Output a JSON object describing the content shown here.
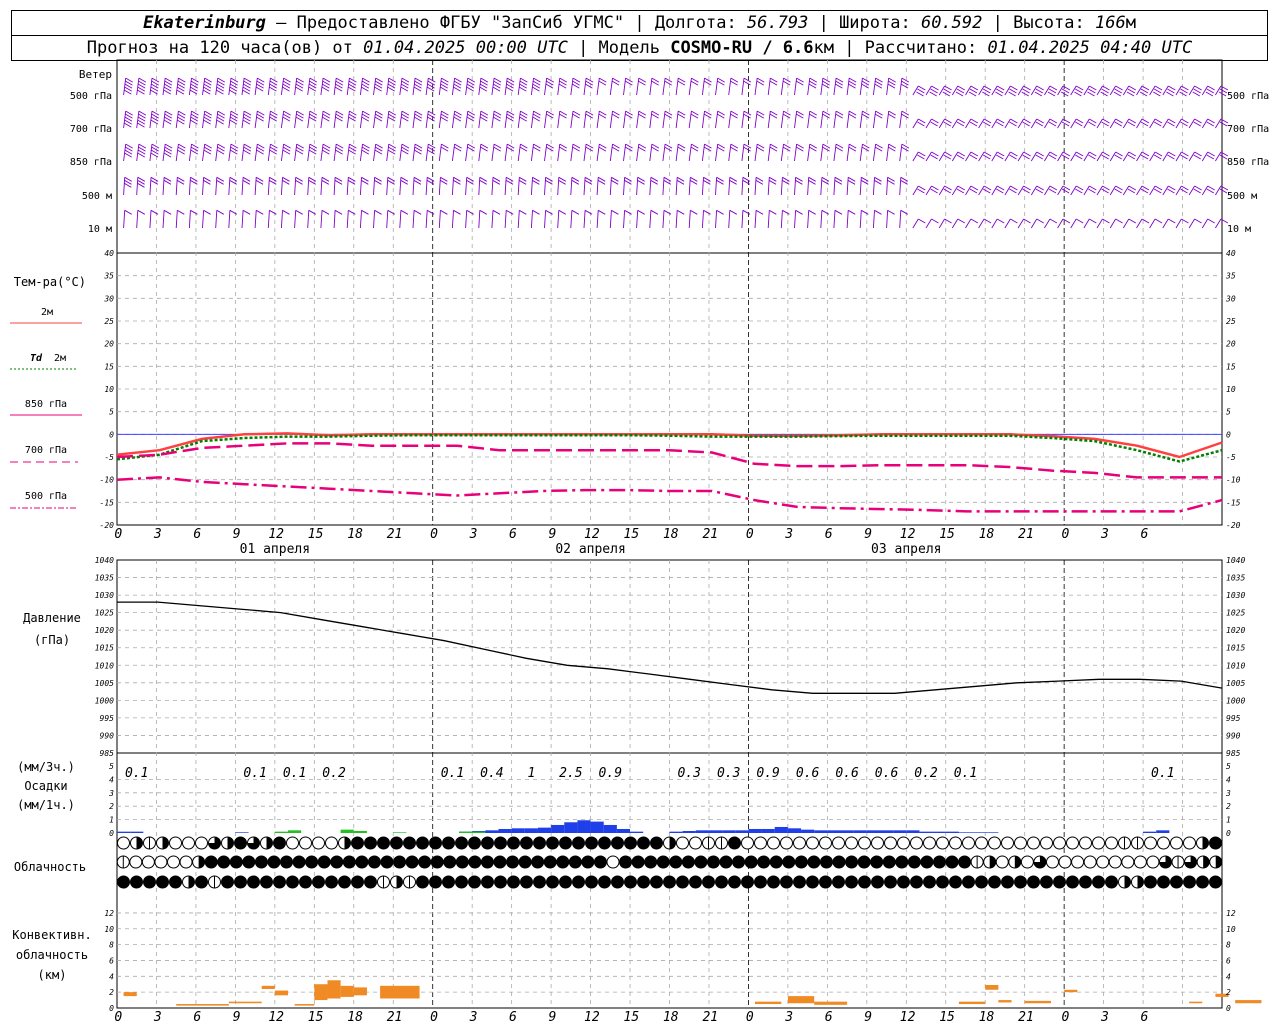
{
  "header": {
    "line1": {
      "station": "Ekaterinburg",
      "provider": " – Предоставлено ФГБУ \"ЗапСиб УГМС\" | Долгота: ",
      "lon": "56.793",
      "lat_label": " | Широта: ",
      "lat": "60.592",
      "alt_label": " | Высота: ",
      "alt": "166",
      "alt_unit": "м"
    },
    "line2": {
      "a": "Прогноз на 120 часа(ов) от ",
      "date": "01.04.2025 00:00 UTC",
      "b": "  | Модель ",
      "model": "COSMO-RU / 6.6",
      "c": "км | Рассчитано: ",
      "calc": "01.04.2025 04:40 UTC"
    }
  },
  "labels": {
    "wind": "Ветер",
    "wind_levels": [
      "500 гПа",
      "700 гПа",
      "850 гПа",
      "500 м",
      "10  м"
    ],
    "temp": "Тем-ра(°С)",
    "t2m": "2м",
    "td": "Td",
    "td2m": "2м",
    "t850": "850 гПа",
    "t700": "700 гПа",
    "t500": "500 гПа",
    "pressure": "Давление",
    "pressure_unit": "(гПа)",
    "precip_unit3": "(мм/3ч.)",
    "precip": "Осадки",
    "precip_unit1": "(мм/1ч.)",
    "cloud": "Облачность",
    "conv1": "Конвективн.",
    "conv2": "облачность",
    "conv3": "(км)"
  },
  "colors": {
    "t2m": "#ff4040",
    "td": "#008000",
    "upper": "#e8007a",
    "wind": "#8000c8",
    "precip_blue": "#1f3fe8",
    "precip_green": "#22c022",
    "conv": "#f08a24",
    "pressure": "#000000",
    "zero": "#4040ff"
  },
  "chart_data": [
    {
      "type": "barbs",
      "title": "Ветер",
      "levels": [
        "500 гПа",
        "700 гПа",
        "850 гПа",
        "500 м",
        "10  м"
      ],
      "speed_ms": {
        "500 гПа": [
          30,
          30,
          28,
          26,
          24,
          22,
          20,
          18,
          18,
          18,
          18,
          18,
          20,
          20,
          20,
          18,
          16,
          14,
          12,
          12,
          12,
          12,
          12,
          12,
          12,
          12,
          14,
          14,
          14,
          14,
          14,
          14,
          14,
          14,
          14,
          14,
          14,
          14,
          14,
          14,
          14
        ],
        "700 гПа": [
          24,
          22,
          20,
          18,
          18,
          16,
          14,
          14,
          14,
          14,
          14,
          14,
          14,
          14,
          14,
          14,
          12,
          12,
          12,
          10,
          10,
          10,
          10,
          10,
          10,
          10,
          10,
          12,
          12,
          12,
          12,
          12,
          12,
          12,
          12,
          12,
          12,
          12,
          12,
          12,
          12
        ],
        "850 гПа": [
          20,
          18,
          16,
          14,
          14,
          14,
          14,
          14,
          14,
          14,
          14,
          14,
          12,
          12,
          12,
          12,
          12,
          12,
          10,
          10,
          10,
          10,
          10,
          10,
          10,
          10,
          10,
          10,
          10,
          10,
          10,
          10,
          10,
          10,
          10,
          10,
          10,
          10,
          10,
          10,
          10
        ],
        "500 м": [
          14,
          12,
          10,
          10,
          10,
          10,
          10,
          10,
          10,
          10,
          10,
          10,
          10,
          10,
          10,
          10,
          10,
          10,
          10,
          8,
          8,
          8,
          8,
          8,
          8,
          8,
          8,
          8,
          8,
          8,
          8,
          8,
          8,
          8,
          8,
          8,
          8,
          8,
          8,
          8,
          8
        ],
        "10  м": [
          4,
          4,
          4,
          4,
          4,
          4,
          4,
          4,
          4,
          4,
          4,
          4,
          4,
          4,
          4,
          4,
          4,
          4,
          4,
          4,
          4,
          4,
          4,
          4,
          4,
          4,
          4,
          4,
          4,
          4,
          4,
          4,
          4,
          4,
          4,
          4,
          4,
          4,
          4,
          4,
          4
        ]
      }
    },
    {
      "type": "line",
      "title": "Тем-ра(°С)",
      "ylim": [
        -20,
        40
      ],
      "x_hours": [
        0,
        3,
        6,
        9,
        12,
        15,
        18,
        21,
        24,
        27,
        30,
        33,
        36,
        39,
        42,
        45,
        48,
        51,
        54,
        57,
        60,
        63,
        66,
        69,
        72,
        75,
        78,
        81,
        84
      ],
      "x_ticks": [
        "0",
        "3",
        "6",
        "9",
        "12",
        "15",
        "18",
        "21",
        "0",
        "3",
        "6",
        "9",
        "12",
        "15",
        "18",
        "21",
        "0",
        "3",
        "6",
        "9",
        "12",
        "15",
        "18",
        "21",
        "0",
        "3",
        "6"
      ],
      "day_labels": [
        "01 апреля",
        "02 апреля",
        "03 апреля"
      ],
      "series": [
        {
          "name": "2м",
          "values": [
            -4.5,
            -3.5,
            -1,
            0,
            0.2,
            -0.2,
            0,
            0,
            0,
            0,
            0,
            0,
            0,
            0,
            0,
            -0.3,
            -0.3,
            -0.2,
            0,
            0,
            0,
            0,
            -0.4,
            -1,
            -2.5,
            -5,
            -1.8
          ]
        },
        {
          "name": "Td 2м",
          "values": [
            -5.5,
            -4.5,
            -1.5,
            -0.8,
            -0.5,
            -0.5,
            -0.3,
            -0.2,
            -0.2,
            -0.2,
            -0.2,
            -0.2,
            -0.2,
            -0.3,
            -0.5,
            -0.5,
            -0.5,
            -0.4,
            -0.3,
            -0.3,
            -0.3,
            -0.3,
            -0.8,
            -1.5,
            -3.5,
            -6,
            -3.5
          ]
        },
        {
          "name": "850 гПа",
          "values": [
            -5,
            -4.5,
            -3,
            -2.5,
            -2,
            -2,
            -2.5,
            -2.5,
            -2.5,
            -3.5,
            -3.5,
            -3.5,
            -3.5,
            -3.5,
            -4,
            -6.5,
            -7,
            -7,
            -6.8,
            -6.8,
            -6.8,
            -7.2,
            -8,
            -8.5,
            -9.5,
            -9.5,
            -9.5
          ]
        },
        {
          "name": "700 гПа",
          "values": [
            -10,
            -9.5,
            -10.5,
            -11,
            -11.5,
            -12,
            -12.5,
            -13,
            -13.5,
            -13,
            -12.5,
            -12.3,
            -12.3,
            -12.5,
            -12.5,
            -14.5,
            -16,
            -16.3,
            -16.5,
            -16.7,
            -17,
            -17,
            -17,
            -17,
            -17,
            -17,
            -14.5
          ]
        },
        {
          "name": "500 гПа",
          "values": []
        }
      ]
    },
    {
      "type": "line",
      "title": "Давление",
      "ylim": [
        985,
        1040
      ],
      "x_hours": [
        0,
        3,
        6,
        9,
        12,
        15,
        18,
        21,
        24,
        27,
        30,
        33,
        36,
        39,
        42,
        45,
        48,
        51,
        54,
        57,
        60,
        63,
        66,
        69,
        72,
        75,
        78,
        81,
        84
      ],
      "series": [
        {
          "name": "Давление",
          "values": [
            1028,
            1028,
            1027,
            1026,
            1025,
            1023,
            1021,
            1019,
            1017,
            1014.5,
            1012,
            1010,
            1009,
            1007.5,
            1006,
            1004.5,
            1003,
            1002,
            1002,
            1002,
            1003,
            1004,
            1005,
            1005.5,
            1006,
            1006,
            1005.5,
            1003.5
          ]
        }
      ]
    },
    {
      "type": "bar",
      "title": "Осадки",
      "ylim": [
        0,
        5
      ],
      "labels_3h": [
        {
          "h": 1.5,
          "v": "0.1"
        },
        {
          "h": 10.5,
          "v": "0.1"
        },
        {
          "h": 13.5,
          "v": "0.1"
        },
        {
          "h": 16.5,
          "v": "0.2"
        },
        {
          "h": 25.5,
          "v": "0.1"
        },
        {
          "h": 28.5,
          "v": "0.4"
        },
        {
          "h": 31.5,
          "v": "1"
        },
        {
          "h": 34.5,
          "v": "2.5"
        },
        {
          "h": 37.5,
          "v": "0.9"
        },
        {
          "h": 43.5,
          "v": "0.3"
        },
        {
          "h": 46.5,
          "v": "0.3"
        },
        {
          "h": 49.5,
          "v": "0.9"
        },
        {
          "h": 52.5,
          "v": "0.6"
        },
        {
          "h": 55.5,
          "v": "0.6"
        },
        {
          "h": 58.5,
          "v": "0.6"
        },
        {
          "h": 61.5,
          "v": "0.2"
        },
        {
          "h": 64.5,
          "v": "0.1"
        },
        {
          "h": 79.5,
          "v": "0.1"
        }
      ],
      "hourly_blue": [
        0.1,
        0.1,
        0,
        0,
        0,
        0,
        0,
        0,
        0,
        0.05,
        0,
        0,
        0,
        0,
        0,
        0,
        0,
        0,
        0,
        0,
        0,
        0,
        0,
        0,
        0,
        0,
        0.1,
        0.15,
        0.2,
        0.3,
        0.35,
        0.35,
        0.4,
        0.6,
        0.8,
        0.95,
        0.85,
        0.6,
        0.3,
        0.1,
        0,
        0,
        0.1,
        0.15,
        0.2,
        0.2,
        0.2,
        0.2,
        0.3,
        0.3,
        0.45,
        0.35,
        0.25,
        0.2,
        0.2,
        0.2,
        0.2,
        0.2,
        0.2,
        0.2,
        0.2,
        0.1,
        0.1,
        0.1,
        0.05,
        0.05,
        0.05,
        0,
        0,
        0,
        0,
        0,
        0,
        0,
        0,
        0,
        0,
        0,
        0.1,
        0.2
      ],
      "hourly_green": [
        0,
        0,
        0,
        0,
        0,
        0,
        0,
        0,
        0,
        0,
        0,
        0,
        0.1,
        0.2,
        0,
        0,
        0,
        0.25,
        0.15,
        0,
        0,
        0.05,
        0,
        0,
        0,
        0,
        0.1,
        0.1,
        0,
        0,
        0,
        0,
        0,
        0,
        0,
        0,
        0,
        0,
        0,
        0,
        0,
        0,
        0,
        0,
        0,
        0,
        0,
        0,
        0,
        0,
        0,
        0,
        0,
        0,
        0,
        0,
        0,
        0,
        0,
        0,
        0,
        0,
        0,
        0,
        0,
        0,
        0,
        0,
        0,
        0,
        0,
        0,
        0,
        0,
        0,
        0,
        0,
        0,
        0,
        0
      ]
    },
    {
      "type": "table",
      "title": "Облачность",
      "rows": [
        "high",
        "mid",
        "low"
      ],
      "levels": {
        "high": [
          0,
          2,
          1,
          2,
          0,
          0,
          0,
          3,
          2,
          4,
          3,
          2,
          4,
          0,
          0,
          0,
          0,
          2,
          4,
          4,
          4,
          4,
          4,
          4,
          4,
          4,
          4,
          4,
          4,
          4,
          4,
          4,
          4,
          4,
          4,
          4,
          4,
          4,
          4,
          4,
          4,
          4,
          2,
          0,
          0,
          1,
          1,
          4,
          0,
          0,
          0,
          0,
          0,
          0,
          0,
          0,
          0,
          0,
          0,
          0,
          0,
          0,
          0,
          0,
          0,
          0,
          0,
          0,
          0,
          0,
          0,
          0,
          0,
          0,
          0,
          0,
          0,
          1,
          1,
          0,
          0,
          0,
          0,
          2,
          4
        ],
        "mid": [
          1,
          0,
          0,
          0,
          0,
          0,
          2,
          4,
          4,
          4,
          4,
          4,
          4,
          4,
          4,
          4,
          4,
          4,
          4,
          4,
          4,
          4,
          4,
          4,
          4,
          4,
          4,
          4,
          4,
          4,
          4,
          4,
          4,
          4,
          4,
          4,
          4,
          4,
          4,
          0,
          4,
          4,
          4,
          4,
          4,
          4,
          4,
          4,
          4,
          4,
          4,
          4,
          4,
          4,
          4,
          4,
          4,
          4,
          4,
          4,
          4,
          4,
          4,
          4,
          4,
          4,
          4,
          4,
          1,
          2,
          0,
          2,
          0,
          3,
          0,
          0,
          0,
          0,
          0,
          0,
          0,
          0,
          0,
          3,
          1,
          3,
          2,
          2
        ],
        "low": [
          4,
          4,
          4,
          4,
          4,
          2,
          4,
          1,
          4,
          4,
          4,
          4,
          4,
          4,
          4,
          4,
          4,
          4,
          4,
          4,
          1,
          2,
          1,
          4,
          4,
          4,
          4,
          4,
          4,
          4,
          4,
          4,
          4,
          4,
          4,
          4,
          4,
          4,
          4,
          4,
          4,
          4,
          4,
          4,
          4,
          4,
          4,
          4,
          4,
          4,
          4,
          4,
          4,
          4,
          4,
          4,
          4,
          4,
          4,
          4,
          4,
          4,
          4,
          4,
          4,
          4,
          4,
          4,
          4,
          4,
          4,
          4,
          4,
          4,
          4,
          4,
          4,
          2,
          2,
          4,
          4,
          4,
          4,
          4,
          4
        ]
      }
    },
    {
      "type": "bar",
      "title": "Конвективн. облачность",
      "ylim": [
        0,
        13
      ],
      "y_ticks": [
        0,
        2,
        4,
        6,
        8,
        10,
        12
      ],
      "bars": [
        {
          "h0": 0.5,
          "h1": 1.5,
          "base": 1.5,
          "top": 2
        },
        {
          "h0": 4.5,
          "h1": 8.5,
          "base": 0.3,
          "top": 0.5
        },
        {
          "h0": 8.5,
          "h1": 11,
          "base": 0.6,
          "top": 0.8
        },
        {
          "h0": 11,
          "h1": 12,
          "base": 2.4,
          "top": 2.8
        },
        {
          "h0": 12,
          "h1": 13,
          "base": 1.6,
          "top": 2.2
        },
        {
          "h0": 13.5,
          "h1": 15,
          "base": 0.3,
          "top": 0.5
        },
        {
          "h0": 15,
          "h1": 16,
          "base": 1,
          "top": 3
        },
        {
          "h0": 16,
          "h1": 17,
          "base": 1.2,
          "top": 3.5
        },
        {
          "h0": 17,
          "h1": 18,
          "base": 1.4,
          "top": 2.8
        },
        {
          "h0": 18,
          "h1": 19,
          "base": 1.6,
          "top": 2.6
        },
        {
          "h0": 20,
          "h1": 23,
          "base": 1.2,
          "top": 2.8
        },
        {
          "h0": 48.5,
          "h1": 50.5,
          "base": 0.5,
          "top": 0.8
        },
        {
          "h0": 51,
          "h1": 53,
          "base": 0.6,
          "top": 1.5
        },
        {
          "h0": 53,
          "h1": 55.5,
          "base": 0.4,
          "top": 0.8
        },
        {
          "h0": 64,
          "h1": 66,
          "base": 0.5,
          "top": 0.8
        },
        {
          "h0": 66,
          "h1": 67,
          "base": 2.3,
          "top": 2.9
        },
        {
          "h0": 67,
          "h1": 68,
          "base": 0.7,
          "top": 1
        },
        {
          "h0": 69,
          "h1": 71,
          "base": 0.6,
          "top": 0.9
        },
        {
          "h0": 72,
          "h1": 73,
          "base": 2,
          "top": 2.3
        },
        {
          "h0": 81.5,
          "h1": 82.5,
          "base": 0.6,
          "top": 0.8
        },
        {
          "h0": 83.5,
          "h1": 84.5,
          "base": 1.4,
          "top": 1.8
        },
        {
          "h0": 85,
          "h1": 87,
          "base": 0.6,
          "top": 1
        }
      ]
    }
  ]
}
